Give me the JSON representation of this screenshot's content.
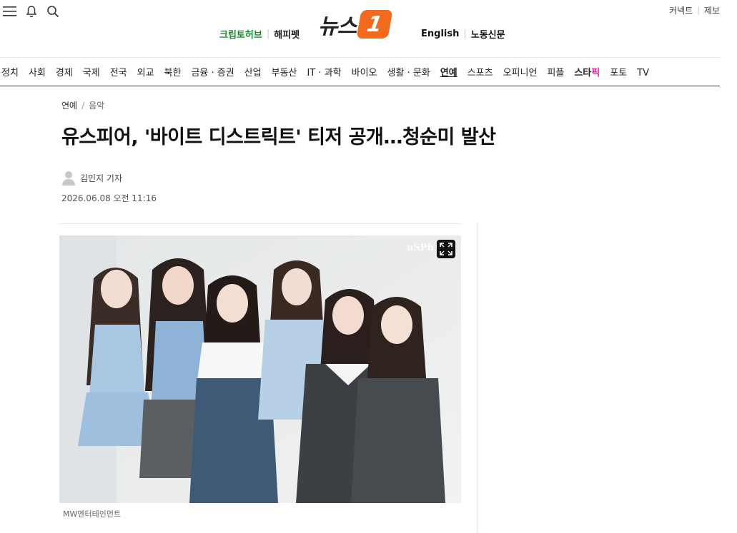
{
  "header": {
    "icons": [
      "menu-icon",
      "bell-icon",
      "search-icon"
    ],
    "util_links": [
      "커넥트",
      "제보"
    ],
    "partners_left": [
      "크립토허브",
      "해피펫"
    ],
    "logo_word": "뉴스",
    "logo_one": "1",
    "partners_right": [
      "English",
      "노동신문"
    ]
  },
  "nav": {
    "items": [
      "정치",
      "사회",
      "경제",
      "국제",
      "전국",
      "외교",
      "북한",
      "금융 · 증권",
      "산업",
      "부동산",
      "IT · 과학",
      "바이오",
      "생활 · 문화",
      "연예",
      "스포츠",
      "오피니언",
      "피플"
    ],
    "active": "연예",
    "star_main": "스타",
    "star_pick": "픽",
    "tail": [
      "포토",
      "TV"
    ]
  },
  "article": {
    "section": "연예",
    "subsection": "음악",
    "title": "유스피어, '바이트 디스트릭트' 티저 공개…청순미 발산",
    "author": "김민지 기자",
    "date": "2026.06.08 오전 11:16",
    "photo_watermark": "uSPh",
    "photo_caption": "MW엔터테인먼트"
  },
  "colors": {
    "brand_orange": "#f26b1d",
    "crypto_green": "#1a8c2e",
    "star_pink": "#e0249a"
  }
}
